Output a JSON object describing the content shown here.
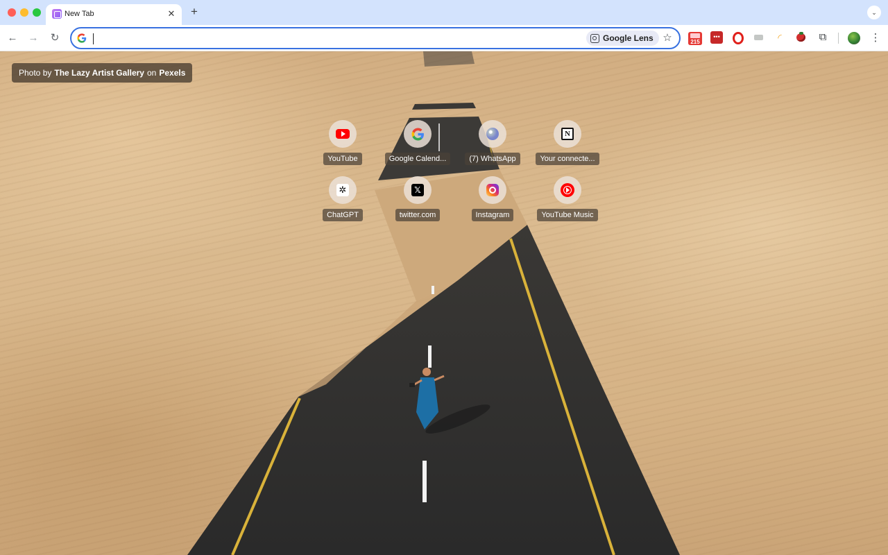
{
  "tabs": [
    {
      "title": "New Tab",
      "icon": "new-tab-favicon"
    }
  ],
  "tabstrip": {
    "new_tab_symbol": "+",
    "close_symbol": "✕",
    "tab_search_symbol": "⌄"
  },
  "toolbar": {
    "back_symbol": "←",
    "forward_symbol": "→",
    "reload_symbol": "↻",
    "omnibox_value": "",
    "lens_label": "Google Lens",
    "bookmark_symbol": "☆",
    "calendar_badge": "215",
    "menu_symbol": "⋮",
    "extensions_symbol": "⧉"
  },
  "credit": {
    "prefix": "Photo by",
    "author": "The Lazy Artist Gallery",
    "middle": "on",
    "site": "Pexels"
  },
  "shortcuts": [
    {
      "label": "YouTube",
      "icon": "youtube-icon"
    },
    {
      "label": "Google Calend...",
      "icon": "google-icon"
    },
    {
      "label": "(7) WhatsApp",
      "icon": "whatsapp-icon"
    },
    {
      "label": "Your connecte...",
      "icon": "notion-icon"
    },
    {
      "label": "ChatGPT",
      "icon": "chatgpt-icon"
    },
    {
      "label": "twitter.com",
      "icon": "x-icon"
    },
    {
      "label": "Instagram",
      "icon": "instagram-icon"
    },
    {
      "label": "YouTube Music",
      "icon": "youtube-music-icon"
    }
  ],
  "icon_glyphs": {
    "notion": "N",
    "chatgpt": "✲",
    "x": "𝕏",
    "rss": "◜"
  },
  "colors": {
    "tabstrip": "#d3e3fd",
    "omnibox_border": "#3871e0",
    "sand": "#d6b386",
    "road": "#2f2f2f"
  }
}
